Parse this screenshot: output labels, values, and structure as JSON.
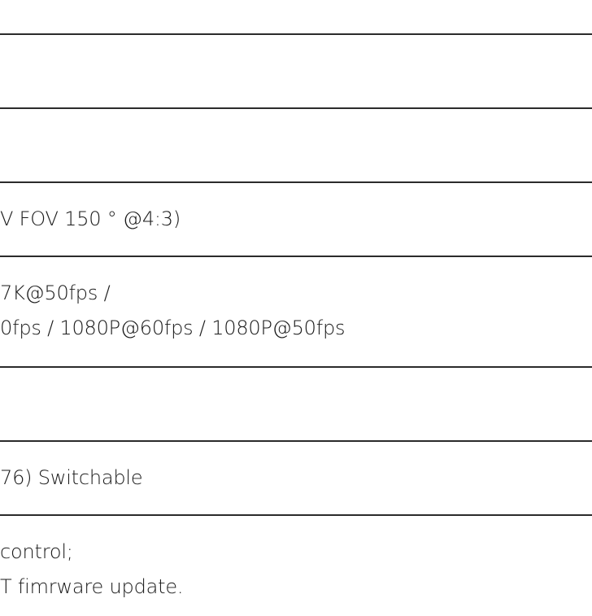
{
  "rows": [
    {
      "lines": []
    },
    {
      "lines": []
    },
    {
      "lines": [
        "V FOV 150 ° @4:3)"
      ]
    },
    {
      "lines": [
        "7K@50fps /",
        "0fps / 1080P@60fps / 1080P@50fps"
      ]
    },
    {
      "lines": []
    },
    {
      "lines": [
        "76) Switchable"
      ]
    },
    {
      "lines": [
        "control;",
        "T fimrware update."
      ]
    }
  ]
}
